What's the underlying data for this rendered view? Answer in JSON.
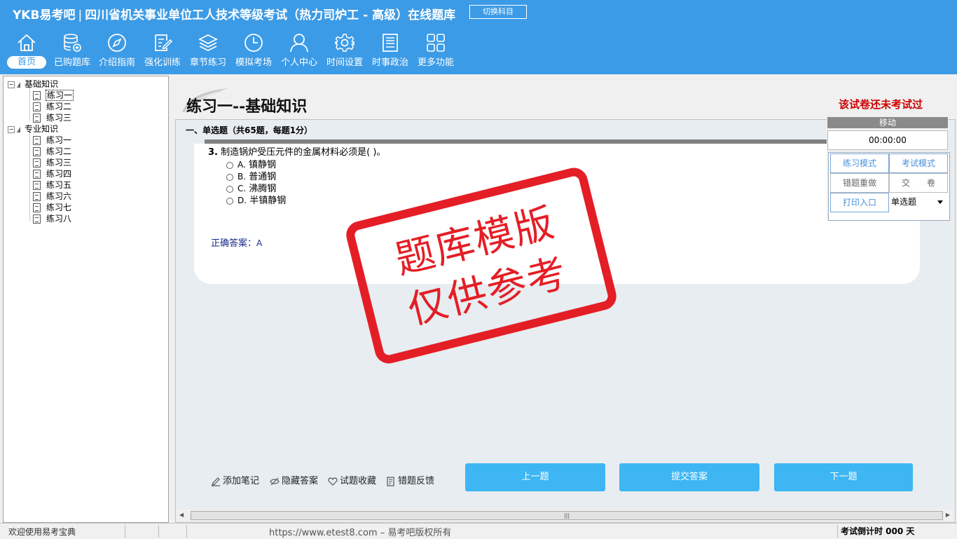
{
  "header": {
    "logo": "YKB易考吧",
    "separator": "|",
    "title": "四川省机关事业单位工人技术等级考试（热力司炉工 - 高级）在线题库",
    "switch_subject": "切换科目"
  },
  "nav": [
    {
      "label": "首页",
      "icon": "home-icon"
    },
    {
      "label": "已购题库",
      "icon": "database-icon"
    },
    {
      "label": "介绍指南",
      "icon": "compass-icon"
    },
    {
      "label": "强化训练",
      "icon": "edit-icon"
    },
    {
      "label": "章节练习",
      "icon": "layers-icon"
    },
    {
      "label": "模拟考场",
      "icon": "clock-icon"
    },
    {
      "label": "个人中心",
      "icon": "user-icon"
    },
    {
      "label": "时间设置",
      "icon": "gear-icon"
    },
    {
      "label": "时事政治",
      "icon": "news-icon"
    },
    {
      "label": "更多功能",
      "icon": "grid-icon"
    }
  ],
  "tree": {
    "group1": {
      "label": "基础知识",
      "items": [
        "练习一",
        "练习二",
        "练习三"
      ]
    },
    "group2": {
      "label": "专业知识",
      "items": [
        "练习一",
        "练习二",
        "练习三",
        "练习四",
        "练习五",
        "练习六",
        "练习七",
        "练习八"
      ]
    }
  },
  "main": {
    "title": "练习一--基础知识",
    "exam_status": "该试卷还未考试过",
    "section_header": "一、单选题（共65题，每题1分）",
    "question_number": "3.",
    "question_text": "制造锅炉受压元件的金属材料必须是(  )。",
    "options": [
      {
        "key": "A.",
        "text": "镇静钢"
      },
      {
        "key": "B.",
        "text": "普通钢"
      },
      {
        "key": "C.",
        "text": "沸腾钢"
      },
      {
        "key": "D.",
        "text": "半镇静钢"
      }
    ],
    "answer_label": "正确答案：",
    "answer_value": "A"
  },
  "stamp": {
    "line1": "题库模版",
    "line2": "仅供参考"
  },
  "panel": {
    "move": "移动",
    "timer": "00:00:00",
    "practice_mode": "练习模式",
    "exam_mode": "考试模式",
    "redo_wrong": "错题重做",
    "submit_paper": "交　　卷",
    "print_entry": "打印入口",
    "question_type": "单选题"
  },
  "actions": {
    "add_note": "添加笔记",
    "hide_answer": "隐藏答案",
    "favorite": "试题收藏",
    "feedback": "错题反馈",
    "prev": "上一题",
    "submit": "提交答案",
    "next": "下一题"
  },
  "status": {
    "welcome": "欢迎使用易考宝典",
    "copyright": "https://www.etest8.com – 易考吧版权所有",
    "countdown": "考试倒计时 000 天"
  },
  "colors": {
    "header_bg": "#3c9be6",
    "button_blue": "#3db6f3",
    "stamp_red": "#e41e26",
    "status_red": "#cc0000"
  }
}
